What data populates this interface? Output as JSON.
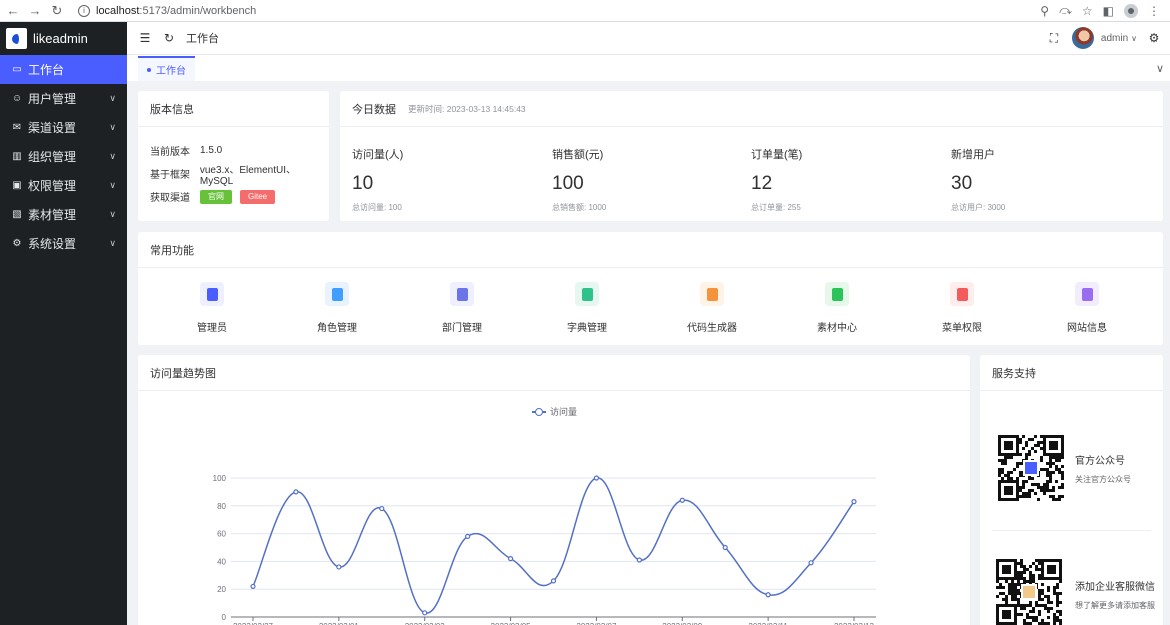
{
  "browser": {
    "url_host": "localhost",
    "url_path": ":5173/admin/workbench"
  },
  "sidebar": {
    "brand": "likeadmin",
    "items": [
      {
        "label": "工作台",
        "icon": "monitor-icon",
        "active": true,
        "has_children": false
      },
      {
        "label": "用户管理",
        "icon": "user-icon",
        "active": false,
        "has_children": true
      },
      {
        "label": "渠道设置",
        "icon": "mail-icon",
        "active": false,
        "has_children": true
      },
      {
        "label": "组织管理",
        "icon": "building-icon",
        "active": false,
        "has_children": true
      },
      {
        "label": "权限管理",
        "icon": "lock-icon",
        "active": false,
        "has_children": true
      },
      {
        "label": "素材管理",
        "icon": "image-icon",
        "active": false,
        "has_children": true
      },
      {
        "label": "系统设置",
        "icon": "gear-icon",
        "active": false,
        "has_children": true
      }
    ]
  },
  "header": {
    "title": "工作台",
    "user_name": "admin"
  },
  "tabs": [
    {
      "label": "工作台",
      "active": true
    }
  ],
  "version_card": {
    "title": "版本信息",
    "rows": [
      {
        "key": "当前版本",
        "value": "1.5.0"
      },
      {
        "key": "基于框架",
        "value": "vue3.x、ElementUI、MySQL"
      },
      {
        "key": "获取渠道",
        "value": ""
      }
    ],
    "tags": [
      {
        "label": "官网",
        "color": "#67c23a"
      },
      {
        "label": "Gitee",
        "color": "#f56c6c"
      }
    ]
  },
  "today_card": {
    "title": "今日数据",
    "updated": "更新时间: 2023-03-13 14:45:43",
    "stats": [
      {
        "label": "访问量(人)",
        "value": "10",
        "sub": "总访问量: 100"
      },
      {
        "label": "销售额(元)",
        "value": "100",
        "sub": "总销售额: 1000"
      },
      {
        "label": "订单量(笔)",
        "value": "12",
        "sub": "总订单量: 255"
      },
      {
        "label": "新增用户",
        "value": "30",
        "sub": "总访用户: 3000"
      }
    ]
  },
  "functions_card": {
    "title": "常用功能",
    "items": [
      {
        "label": "管理员",
        "icon": "admin-icon",
        "bg": "#eef0ff",
        "fg": "#4a5dff"
      },
      {
        "label": "角色管理",
        "icon": "role-icon",
        "bg": "#e8f3ff",
        "fg": "#409eff"
      },
      {
        "label": "部门管理",
        "icon": "department-icon",
        "bg": "#eef0ff",
        "fg": "#6b74e8"
      },
      {
        "label": "字典管理",
        "icon": "dictionary-icon",
        "bg": "#e6f7f2",
        "fg": "#2fc28c"
      },
      {
        "label": "代码生成器",
        "icon": "code-icon",
        "bg": "#fff3e8",
        "fg": "#f5933c"
      },
      {
        "label": "素材中心",
        "icon": "material-icon",
        "bg": "#e6f8ea",
        "fg": "#2dc35b"
      },
      {
        "label": "菜单权限",
        "icon": "menu-icon",
        "bg": "#ffecec",
        "fg": "#f25c5c"
      },
      {
        "label": "网站信息",
        "icon": "website-icon",
        "bg": "#f3ecff",
        "fg": "#9a6cf0"
      }
    ]
  },
  "trend_card": {
    "title": "访问量趋势图"
  },
  "chart_data": {
    "type": "line",
    "title": "",
    "series": [
      {
        "name": "访问量",
        "values": [
          22,
          90,
          36,
          78,
          3,
          58,
          42,
          26,
          100,
          41,
          84,
          50,
          16,
          39,
          83
        ]
      }
    ],
    "x": [
      "2023/02/27",
      "2023/02/28",
      "2023/03/01",
      "2023/03/02",
      "2023/03/03",
      "2023/03/04",
      "2023/03/05",
      "2023/03/06",
      "2023/03/07",
      "2023/03/08",
      "2023/03/09",
      "2023/03/10",
      "2023/03/11",
      "2023/03/12",
      "2023/03/13"
    ],
    "x_tick_labels": [
      "2023/02/27",
      "2023/03/01",
      "2023/03/03",
      "2023/03/05",
      "2023/03/07",
      "2023/03/09",
      "2023/03/11",
      "2023/03/13"
    ],
    "ylim": [
      0,
      100
    ],
    "y_ticks": [
      "0",
      "20",
      "40",
      "60",
      "80",
      "100"
    ],
    "xlabel": "",
    "ylabel": "",
    "grid": true,
    "legend": "top-center",
    "smooth": true,
    "color": "#5470c6"
  },
  "service_card": {
    "title": "服务支持",
    "items": [
      {
        "title": "官方公众号",
        "sub": "关注官方公众号"
      },
      {
        "title": "添加企业客服微信",
        "sub": "想了解更多请添加客服"
      }
    ]
  }
}
